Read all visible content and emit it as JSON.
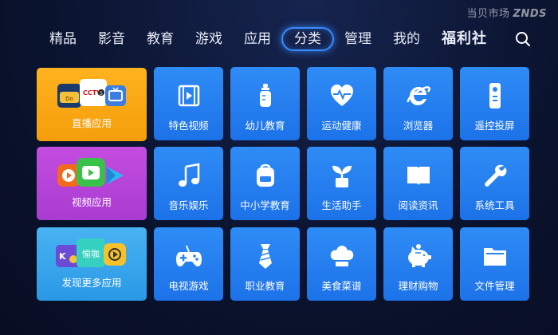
{
  "watermark": {
    "text": "当贝市场",
    "brand": "ZNDS"
  },
  "nav": {
    "items": [
      "精品",
      "影音",
      "教育",
      "游戏",
      "应用",
      "分类",
      "管理",
      "我的"
    ],
    "active": "分类",
    "welfare": "福利社"
  },
  "big_tiles": {
    "live": "直播应用",
    "video": "视频应用",
    "discover": "发现更多应用"
  },
  "tiles": [
    {
      "label": "特色视频",
      "icon": "video-icon"
    },
    {
      "label": "幼儿教育",
      "icon": "baby-bottle-icon"
    },
    {
      "label": "运动健康",
      "icon": "heart-pulse-icon"
    },
    {
      "label": "浏览器",
      "icon": "browser-icon"
    },
    {
      "label": "遥控投屏",
      "icon": "remote-icon"
    },
    {
      "label": "音乐娱乐",
      "icon": "music-icon"
    },
    {
      "label": "中小学教育",
      "icon": "schoolbag-icon"
    },
    {
      "label": "生活助手",
      "icon": "plant-icon"
    },
    {
      "label": "阅读资讯",
      "icon": "book-icon"
    },
    {
      "label": "系统工具",
      "icon": "wrench-icon"
    },
    {
      "label": "电视游戏",
      "icon": "gamepad-icon"
    },
    {
      "label": "职业教育",
      "icon": "tie-icon"
    },
    {
      "label": "美食菜谱",
      "icon": "chef-hat-icon"
    },
    {
      "label": "理财购物",
      "icon": "piggy-bank-icon"
    },
    {
      "label": "文件管理",
      "icon": "folder-icon"
    }
  ],
  "app_logo_text": {
    "cctv": "CCTV",
    "cctv_num": "5",
    "iqiyi": "愉咖"
  },
  "colors": {
    "tile_blue": "#2a84f3",
    "live_orange": "#ffb21f",
    "video_purple": "#b945d8",
    "discover_blue": "#3aa6ee",
    "active_nav": "#3a8bff"
  }
}
